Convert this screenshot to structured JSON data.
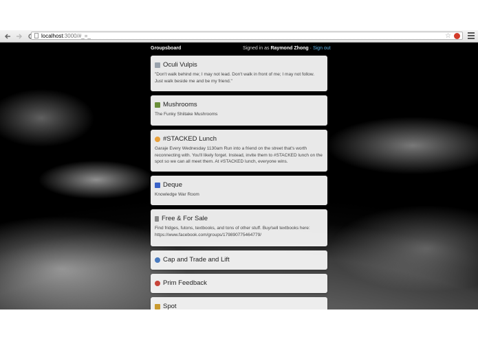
{
  "browser": {
    "url_host": "localhost",
    "url_rest": ":3000/#_=_",
    "icons": [
      "back-arrow-icon",
      "forward-arrow-icon",
      "reload-icon",
      "star-icon",
      "extension-icon",
      "menu-icon"
    ]
  },
  "header": {
    "brand": "Groupsboard",
    "signed_prefix": "Signed in as",
    "user": "Raymond Zhong",
    "separator": "·",
    "signout": "Sign out"
  },
  "groups": [
    {
      "title": "Oculi Vulpis",
      "desc": "\"Don't walk behind me; I may not lead. Don't walk in front of me; I may not follow. Just walk beside me and be my friend.\"",
      "icon": "fox-icon",
      "icon_color": "#9aa3ad"
    },
    {
      "title": "Mushrooms",
      "desc": "The Funky Shiitake Mushrooms",
      "icon": "mushroom-icon",
      "icon_color": "#6a8f3a"
    },
    {
      "title": "#STACKED Lunch",
      "desc": "Garaje Every Wednesday 1130am Run into a friend on the street that's worth reconnecting with. You'll likely forget. Instead, invite them to #STACKED lunch on the spot so we can all meet them. At #STACKED lunch, everyone wins.",
      "icon": "food-icon",
      "icon_color": "#e8a03a"
    },
    {
      "title": "Deque",
      "desc": "Knowledge War Room",
      "icon": "book-icon",
      "icon_color": "#3a63c8"
    },
    {
      "title": "Free & For Sale",
      "desc": "Find fridges, futons, textbooks, and tons of other stuff. Buy/sell textbooks here: https://www.facebook.com/groups/179890775464779/",
      "icon": "trash-icon",
      "icon_color": "#8a8a8a"
    },
    {
      "title": "Cap and Trade and Lift",
      "desc": "",
      "icon": "globe-icon",
      "icon_color": "#4a7bbf"
    },
    {
      "title": "Prim Feedback",
      "desc": "",
      "icon": "speech-icon",
      "icon_color": "#c8453a"
    },
    {
      "title": "Spot",
      "desc": "",
      "icon": "spot-icon",
      "icon_color": "#c99a2e"
    }
  ]
}
